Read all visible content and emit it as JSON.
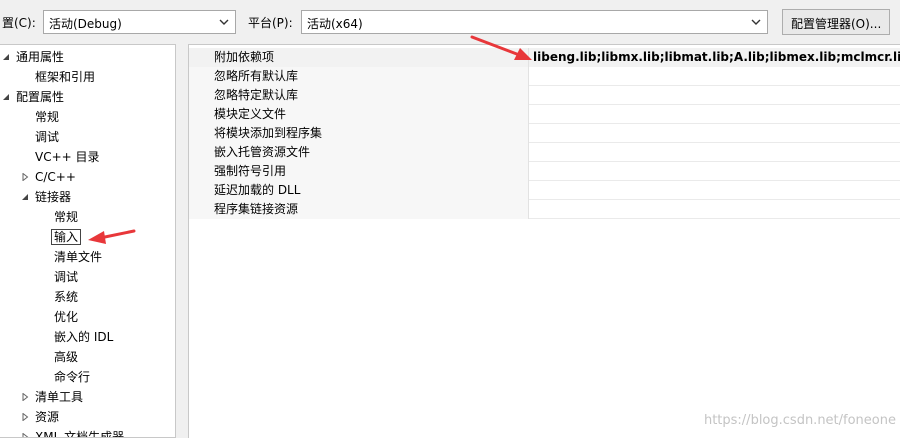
{
  "toolbar": {
    "config_label": "置(C):",
    "config_value": "活动(Debug)",
    "platform_label": "平台(P):",
    "platform_value": "活动(x64)",
    "config_manager_button": "配置管理器(O)..."
  },
  "tree": {
    "items": [
      {
        "label": "通用属性",
        "expander": "expanded"
      },
      {
        "label": "框架和引用",
        "expander": ""
      },
      {
        "label": "配置属性",
        "expander": "expanded"
      },
      {
        "label": "常规",
        "expander": ""
      },
      {
        "label": "调试",
        "expander": ""
      },
      {
        "label": "VC++ 目录",
        "expander": ""
      },
      {
        "label": "C/C++",
        "expander": "collapsed"
      },
      {
        "label": "链接器",
        "expander": "expanded"
      },
      {
        "label": "常规",
        "expander": ""
      },
      {
        "label": "输入",
        "expander": "",
        "selected": true
      },
      {
        "label": "清单文件",
        "expander": ""
      },
      {
        "label": "调试",
        "expander": ""
      },
      {
        "label": "系统",
        "expander": ""
      },
      {
        "label": "优化",
        "expander": ""
      },
      {
        "label": "嵌入的 IDL",
        "expander": ""
      },
      {
        "label": "高级",
        "expander": ""
      },
      {
        "label": "命令行",
        "expander": ""
      },
      {
        "label": "清单工具",
        "expander": "collapsed"
      },
      {
        "label": "资源",
        "expander": "collapsed"
      },
      {
        "label": "XML 文档生成器",
        "expander": "collapsed"
      }
    ]
  },
  "grid": {
    "rows": [
      {
        "name": "附加依赖项",
        "value": "libeng.lib;libmx.lib;libmat.lib;A.lib;libmex.lib;mclmcr.lib;mc"
      },
      {
        "name": "忽略所有默认库",
        "value": ""
      },
      {
        "name": "忽略特定默认库",
        "value": ""
      },
      {
        "name": "模块定义文件",
        "value": ""
      },
      {
        "name": "将模块添加到程序集",
        "value": ""
      },
      {
        "name": "嵌入托管资源文件",
        "value": ""
      },
      {
        "name": "强制符号引用",
        "value": ""
      },
      {
        "name": "延迟加载的 DLL",
        "value": ""
      },
      {
        "name": "程序集链接资源",
        "value": ""
      }
    ]
  },
  "watermark": "https://blog.csdn.net/foneone",
  "colors": {
    "annotation_arrow": "#e8373a",
    "selection_outline": "#444444"
  }
}
